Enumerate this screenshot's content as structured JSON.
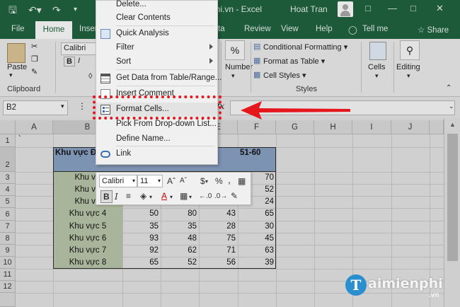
{
  "window": {
    "title": "phi.vn  -  Excel",
    "user": "Hoat Tran"
  },
  "tabs": [
    "File",
    "Home",
    "Inser",
    "ta",
    "Review",
    "View",
    "Help",
    "Tell me",
    "Share"
  ],
  "ribbon": {
    "clipboard": {
      "paste": "Paste",
      "group": "Clipboard"
    },
    "font": {
      "name": "Calibri",
      "bold": "B",
      "italic": "I"
    },
    "number": {
      "percent": "%",
      "label": "Number"
    },
    "styles": {
      "conditional": "Conditional Formatting",
      "format_table": "Format as Table",
      "cell_styles": "Cell Styles",
      "group": "Styles"
    },
    "cells": "Cells",
    "editing": "Editing"
  },
  "formula_bar": {
    "name_box": "B2",
    "fx": "fx"
  },
  "context_menu": {
    "items": [
      {
        "label": "Delete...",
        "arrow": false
      },
      {
        "label": "Clear Contents",
        "arrow": false
      },
      {
        "label": "Quick Analysis",
        "arrow": false
      },
      {
        "label": "Filter",
        "arrow": true
      },
      {
        "label": "Sort",
        "arrow": true
      },
      {
        "label": "Get Data from Table/Range...",
        "arrow": false
      },
      {
        "label": "Insert Comment",
        "arrow": false
      },
      {
        "label": "Format Cells...",
        "arrow": false
      },
      {
        "label": "Pick From Drop-down List...",
        "arrow": false
      },
      {
        "label": "Define Name...",
        "arrow": false
      },
      {
        "label": "Link",
        "arrow": false
      }
    ]
  },
  "mini_toolbar": {
    "font": "Calibri",
    "size": "11",
    "bold": "B",
    "italic": "I",
    "currency": "$",
    "percent": "%",
    "comma": ","
  },
  "sheet": {
    "columns": [
      "A",
      "B",
      "C",
      "D",
      "E",
      "F",
      "G",
      "H",
      "I",
      "J"
    ],
    "row_numbers": [
      "1",
      "2",
      "3",
      "4",
      "5",
      "6",
      "7",
      "8",
      "9",
      "10",
      "11",
      "12"
    ],
    "a1": "`",
    "header_b": "Khu vực Đô",
    "header_f": "51-60",
    "rows": [
      {
        "b": "Khu vự",
        "c": "",
        "d": "",
        "e": "",
        "f": "70"
      },
      {
        "b": "Khu vự",
        "c": "",
        "d": "",
        "e": "",
        "f": "52"
      },
      {
        "b": "Khu vự",
        "c": "",
        "d": "",
        "e": "",
        "f": "24"
      },
      {
        "b": "Khu vực 4",
        "c": "50",
        "d": "80",
        "e": "43",
        "f": "65"
      },
      {
        "b": "Khu vực 5",
        "c": "35",
        "d": "35",
        "e": "28",
        "f": "30"
      },
      {
        "b": "Khu vực 6",
        "c": "93",
        "d": "48",
        "e": "75",
        "f": "45"
      },
      {
        "b": "Khu vực 7",
        "c": "92",
        "d": "62",
        "e": "71",
        "f": "63"
      },
      {
        "b": "Khu vực 8",
        "c": "65",
        "d": "52",
        "e": "56",
        "f": "39"
      }
    ]
  },
  "watermark": {
    "logo": "T",
    "text": "aimienphi",
    "sub": ".vn"
  }
}
